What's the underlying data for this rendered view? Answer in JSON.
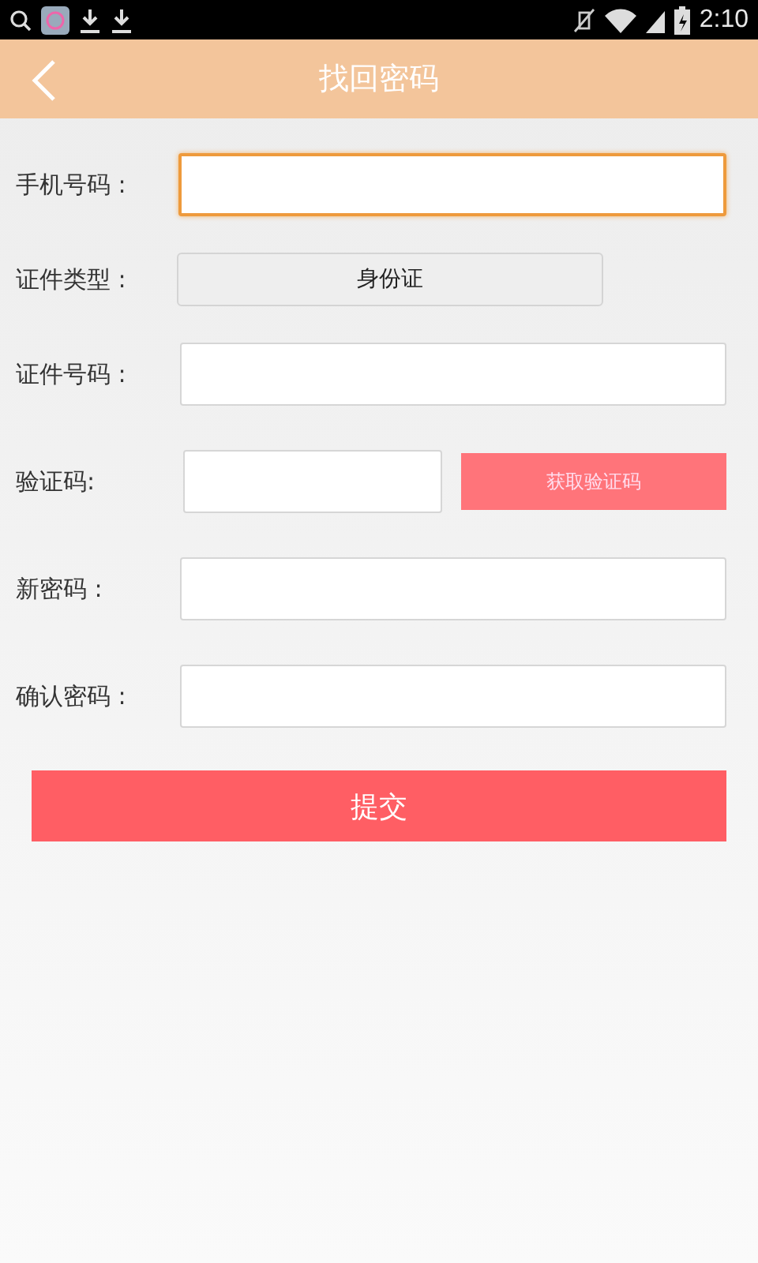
{
  "status_bar": {
    "time": "2:10"
  },
  "header": {
    "title": "找回密码"
  },
  "form": {
    "rows": [
      {
        "kind": "input",
        "label": "手机号码 :",
        "focused": true
      },
      {
        "kind": "select",
        "label": "证件类型 :",
        "value": "身份证"
      },
      {
        "kind": "input",
        "label": "证件号码 :",
        "focused": false
      },
      {
        "kind": "code",
        "label": "验证码:",
        "focused": false,
        "button": "获取验证码"
      },
      {
        "kind": "input",
        "label": "新密码 :",
        "focused": false
      },
      {
        "kind": "input",
        "label": "确认密码 :",
        "focused": false
      }
    ]
  },
  "submit_button": "提交"
}
